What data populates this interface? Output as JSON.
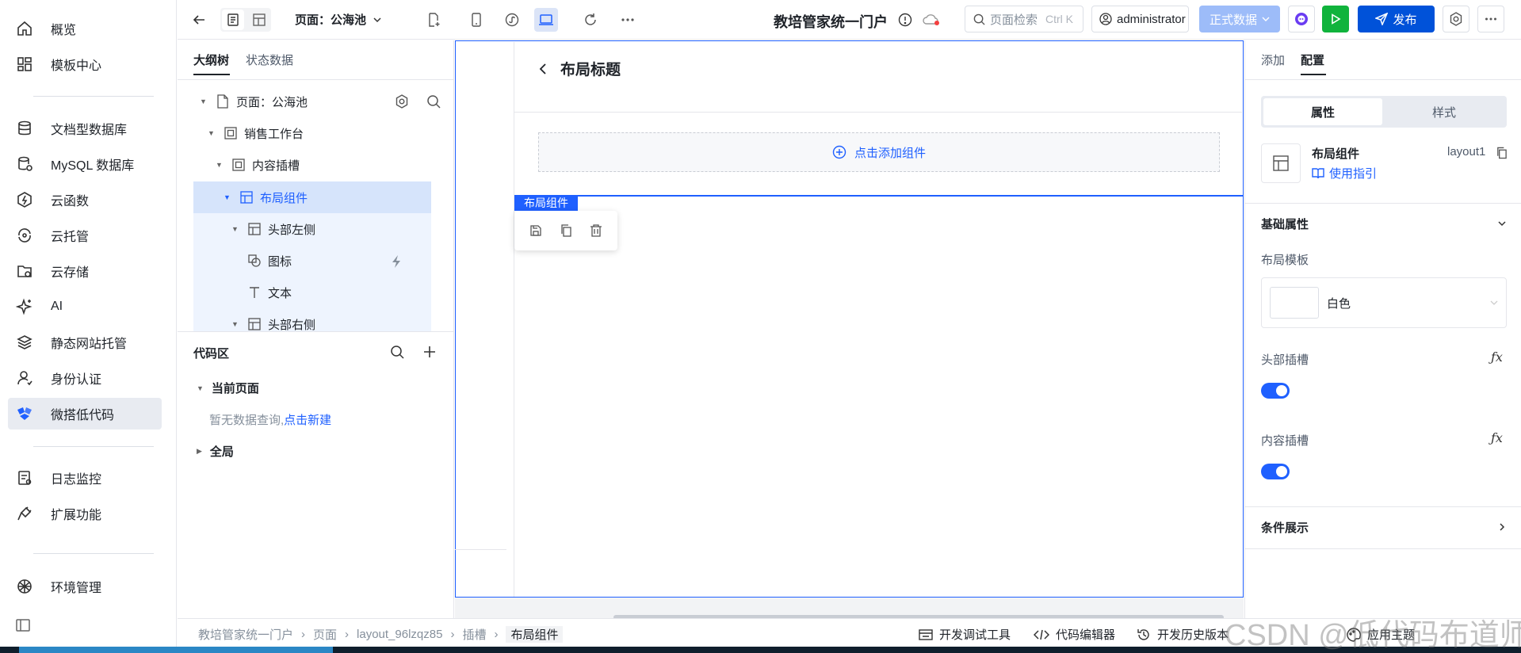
{
  "nav": {
    "items": [
      {
        "label": "概览",
        "icon": "home-icon"
      },
      {
        "label": "模板中心",
        "icon": "grid-icon"
      },
      {
        "label": "文档型数据库",
        "icon": "database-icon"
      },
      {
        "label": "MySQL 数据库",
        "icon": "mysql-icon"
      },
      {
        "label": "云函数",
        "icon": "function-icon"
      },
      {
        "label": "云托管",
        "icon": "cloud-host-icon"
      },
      {
        "label": "云存储",
        "icon": "folder-icon"
      },
      {
        "label": "AI",
        "icon": "sparkle-icon"
      },
      {
        "label": "静态网站托管",
        "icon": "layers-icon"
      },
      {
        "label": "身份认证",
        "icon": "user-icon"
      },
      {
        "label": "微搭低代码",
        "icon": "lowcode-icon"
      },
      {
        "label": "日志监控",
        "icon": "log-icon"
      },
      {
        "label": "扩展功能",
        "icon": "plug-icon"
      },
      {
        "label": "环境管理",
        "icon": "env-icon"
      }
    ],
    "active_index": 10
  },
  "toolbar": {
    "page_selector": "页面：公海池",
    "app_title": "教培管家统一门户",
    "search_placeholder": "页面检索",
    "search_shortcut": "Ctrl K",
    "user": "administrator",
    "data_mode": "正式数据",
    "publish": "发布"
  },
  "outline": {
    "tab_tree": "大纲树",
    "tab_state": "状态数据",
    "tree": [
      {
        "label": "页面：公海池",
        "icon": "page-icon",
        "level": 0
      },
      {
        "label": "销售工作台",
        "icon": "container-icon",
        "level": 1
      },
      {
        "label": "内容插槽",
        "icon": "container-icon",
        "level": 2
      },
      {
        "label": "布局组件",
        "icon": "layout-icon",
        "level": 3
      },
      {
        "label": "头部左侧",
        "icon": "layout-icon",
        "level": 4
      },
      {
        "label": "图标",
        "icon": "shape-icon",
        "level": 5
      },
      {
        "label": "文本",
        "icon": "text-icon",
        "level": 5
      },
      {
        "label": "头部右侧",
        "icon": "layout-icon",
        "level": 4
      }
    ],
    "code_title": "代码区",
    "current_page": "当前页面",
    "empty_text": "暂无数据查询,",
    "create_link": "点击新建",
    "global": "全局"
  },
  "canvas": {
    "header_title": "布局标题",
    "add_component": "点击添加组件",
    "selection_label": "布局组件"
  },
  "right": {
    "tab_add": "添加",
    "tab_config": "配置",
    "seg_props": "属性",
    "seg_style": "样式",
    "component_name": "布局组件",
    "component_id": "layout1",
    "guide_link": "使用指引",
    "section_basic": "基础属性",
    "template_label": "布局模板",
    "template_value": "白色",
    "header_slot_label": "头部插槽",
    "header_slot_on": true,
    "content_slot_label": "内容插槽",
    "content_slot_on": true,
    "condition_label": "条件展示"
  },
  "status": {
    "crumbs": [
      "教培管家统一门户",
      "页面",
      "layout_96lzqz85",
      "插槽",
      "布局组件"
    ],
    "dev_tools": "开发调试工具",
    "code_editor": "代码编辑器",
    "history": "开发历史版本",
    "theme": "应用主题"
  },
  "watermark": "CSDN @低代码布道师",
  "colors": {
    "accent": "#1f60ff",
    "active_bg": "#e8ebf1",
    "tree_sel": "#d6e4fb"
  }
}
